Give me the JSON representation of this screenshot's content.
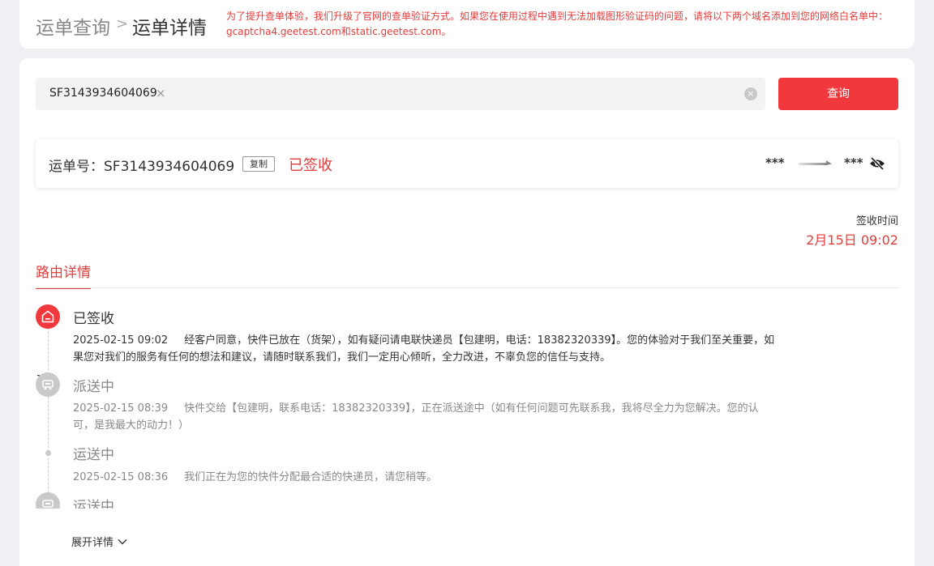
{
  "breadcrumb": {
    "parent": "运单查询",
    "separator": ">",
    "current": "运单详情"
  },
  "notice": "为了提升查单体验，我们升级了官网的查单验证方式。如果您在使用过程中遇到无法加载图形验证码的问题，请将以下两个域名添加到您的网络白名单中：gcaptcha4.geetest.com和static.geetest.com。",
  "search": {
    "tag_value": "SF3143934604069",
    "tag_remove": "×",
    "clear_icon": "×",
    "button_label": "查询"
  },
  "waybill": {
    "label": "运单号：SF3143934604069",
    "copy_label": "复制",
    "status": "已签收",
    "from": "***",
    "to": "***"
  },
  "sign": {
    "label": "签收时间",
    "time": "2月15日 09:02"
  },
  "tabs": {
    "route_detail": "路由详情"
  },
  "timeline": [
    {
      "status": "已签收",
      "time": "2025-02-15 09:02",
      "text": "经客户同意，快件已放在（货架），如有疑问请电联快递员【包建明，电话：18382320339】。您的体验对于我们至关重要，如果您对我们的服务有任何的想法和建议，请随时联系我们，我们一定用心倾听，全力改进，不辜负您的信任与支持。",
      "icon": "house-icon"
    },
    {
      "status": "派送中",
      "time": "2025-02-15 08:39",
      "text": "快件交给【包建明，联系电话：18382320339】，正在派送途中（如有任何问题可先联系我，我将尽全力为您解决。您的认可，是我最大的动力！）",
      "icon": "courier-icon"
    },
    {
      "status": "运送中",
      "time": "2025-02-15 08:36",
      "text": "我们正在为您的快件分配最合适的快递员，请您稍等。",
      "icon": "dot"
    },
    {
      "status": "运送中",
      "time": "",
      "text": "",
      "icon": "courier-icon"
    }
  ],
  "expand_label": "展开详情",
  "colors": {
    "accent": "#f0383d",
    "status_red": "#e23d3d",
    "background": "#eef0f4"
  }
}
